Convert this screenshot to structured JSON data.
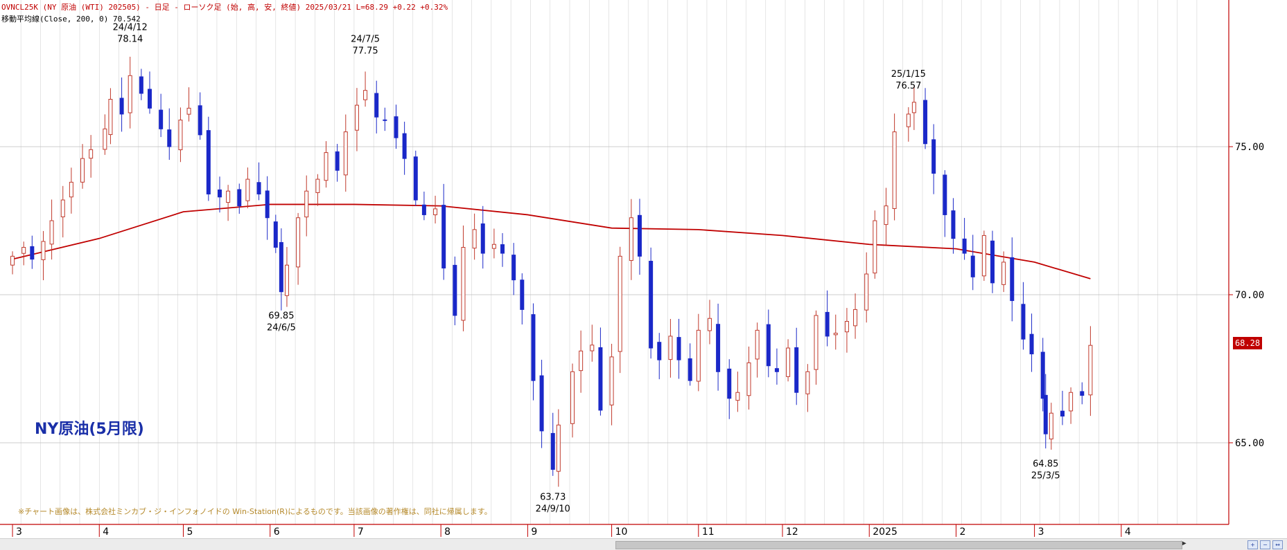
{
  "header": {
    "title": "OVNCL25K (NY 原油 (WTI) 202505) - 日足 - ローソク足 (始, 高, 安, 終値)  2025/03/21 L=68.29 +0.22  +0.32%",
    "ma_line": "移動平均線(Close, 200, 0) 70.542"
  },
  "current_price_label": "68.28",
  "big_label": "NY原油(5月限)",
  "footnote": "※チャート画像は、株式会社ミンカブ・ジ・インフォノイドの Win-Station(R)によるものです。当該画像の著作権は、同社に帰属します。",
  "colors": {
    "up": "#c0392b",
    "down": "#1a28c8",
    "ma": "#c00000",
    "grid": "#d4d4d4",
    "axis_border": "#c00000"
  },
  "chart_data": {
    "type": "candlestick",
    "x_range": [
      "2024-03-01",
      "2025-04-30"
    ],
    "ylim": [
      62.5,
      80
    ],
    "y_ticks": [
      "65.00",
      "70.00",
      "75.00"
    ],
    "month_labels": [
      {
        "label": "3",
        "date": "2024-03-01"
      },
      {
        "label": "4",
        "date": "2024-04-01"
      },
      {
        "label": "5",
        "date": "2024-05-01"
      },
      {
        "label": "6",
        "date": "2024-06-01"
      },
      {
        "label": "7",
        "date": "2024-07-01"
      },
      {
        "label": "8",
        "date": "2024-08-01"
      },
      {
        "label": "9",
        "date": "2024-09-01"
      },
      {
        "label": "10",
        "date": "2024-10-01"
      },
      {
        "label": "11",
        "date": "2024-11-01"
      },
      {
        "label": "12",
        "date": "2024-12-01"
      },
      {
        "label": "2025",
        "date": "2025-01-01"
      },
      {
        "label": "2",
        "date": "2025-02-01"
      },
      {
        "label": "3",
        "date": "2025-03-01"
      },
      {
        "label": "4",
        "date": "2025-04-01"
      }
    ],
    "annotations": [
      {
        "date": "2024-04-12",
        "value": 78.14,
        "lines": [
          "24/4/12",
          "78.14"
        ],
        "pos": "above"
      },
      {
        "date": "2024-06-05",
        "value": 69.85,
        "lines": [
          "69.85",
          "24/6/5"
        ],
        "pos": "below"
      },
      {
        "date": "2024-07-05",
        "value": 77.75,
        "lines": [
          "24/7/5",
          "77.75"
        ],
        "pos": "above"
      },
      {
        "date": "2024-09-10",
        "value": 63.73,
        "lines": [
          "63.73",
          "24/9/10"
        ],
        "pos": "below"
      },
      {
        "date": "2025-01-15",
        "value": 76.57,
        "lines": [
          "25/1/15",
          "76.57"
        ],
        "pos": "above"
      },
      {
        "date": "2025-03-05",
        "value": 64.85,
        "lines": [
          "64.85",
          "25/3/5"
        ],
        "pos": "below"
      }
    ],
    "closes": [
      [
        "2024-03-01",
        71.3
      ],
      [
        "2024-03-05",
        71.6
      ],
      [
        "2024-03-08",
        71.2
      ],
      [
        "2024-03-12",
        71.8
      ],
      [
        "2024-03-15",
        72.5
      ],
      [
        "2024-03-19",
        73.2
      ],
      [
        "2024-03-22",
        73.8
      ],
      [
        "2024-03-26",
        74.6
      ],
      [
        "2024-03-29",
        74.9
      ],
      [
        "2024-04-03",
        75.6
      ],
      [
        "2024-04-05",
        76.6
      ],
      [
        "2024-04-09",
        76.1
      ],
      [
        "2024-04-12",
        77.4
      ],
      [
        "2024-04-16",
        76.8
      ],
      [
        "2024-04-19",
        76.3
      ],
      [
        "2024-04-23",
        75.6
      ],
      [
        "2024-04-26",
        75.0
      ],
      [
        "2024-04-30",
        75.9
      ],
      [
        "2024-05-03",
        76.3
      ],
      [
        "2024-05-07",
        75.4
      ],
      [
        "2024-05-10",
        73.4
      ],
      [
        "2024-05-14",
        73.3
      ],
      [
        "2024-05-17",
        73.5
      ],
      [
        "2024-05-21",
        73.0
      ],
      [
        "2024-05-24",
        73.9
      ],
      [
        "2024-05-28",
        73.4
      ],
      [
        "2024-05-31",
        72.6
      ],
      [
        "2024-06-03",
        71.6
      ],
      [
        "2024-06-05",
        70.1
      ],
      [
        "2024-06-07",
        71.0
      ],
      [
        "2024-06-11",
        72.6
      ],
      [
        "2024-06-14",
        73.5
      ],
      [
        "2024-06-18",
        73.9
      ],
      [
        "2024-06-21",
        74.8
      ],
      [
        "2024-06-25",
        74.2
      ],
      [
        "2024-06-28",
        75.5
      ],
      [
        "2024-07-02",
        76.4
      ],
      [
        "2024-07-05",
        76.9
      ],
      [
        "2024-07-09",
        76.0
      ],
      [
        "2024-07-12",
        75.9
      ],
      [
        "2024-07-16",
        75.3
      ],
      [
        "2024-07-19",
        74.6
      ],
      [
        "2024-07-23",
        73.2
      ],
      [
        "2024-07-26",
        72.7
      ],
      [
        "2024-07-30",
        72.9
      ],
      [
        "2024-08-02",
        70.9
      ],
      [
        "2024-08-06",
        69.3
      ],
      [
        "2024-08-09",
        71.6
      ],
      [
        "2024-08-13",
        72.2
      ],
      [
        "2024-08-16",
        71.4
      ],
      [
        "2024-08-20",
        71.7
      ],
      [
        "2024-08-23",
        71.4
      ],
      [
        "2024-08-27",
        70.5
      ],
      [
        "2024-08-30",
        69.5
      ],
      [
        "2024-09-03",
        67.1
      ],
      [
        "2024-09-06",
        65.4
      ],
      [
        "2024-09-10",
        64.1
      ],
      [
        "2024-09-12",
        65.6
      ],
      [
        "2024-09-17",
        67.4
      ],
      [
        "2024-09-20",
        68.1
      ],
      [
        "2024-09-24",
        68.3
      ],
      [
        "2024-09-27",
        66.1
      ],
      [
        "2024-10-01",
        67.9
      ],
      [
        "2024-10-04",
        71.3
      ],
      [
        "2024-10-08",
        72.6
      ],
      [
        "2024-10-11",
        71.3
      ],
      [
        "2024-10-15",
        68.2
      ],
      [
        "2024-10-18",
        67.8
      ],
      [
        "2024-10-22",
        68.6
      ],
      [
        "2024-10-25",
        67.8
      ],
      [
        "2024-10-29",
        67.1
      ],
      [
        "2024-11-01",
        68.8
      ],
      [
        "2024-11-05",
        69.2
      ],
      [
        "2024-11-08",
        67.4
      ],
      [
        "2024-11-12",
        66.5
      ],
      [
        "2024-11-15",
        66.7
      ],
      [
        "2024-11-19",
        67.7
      ],
      [
        "2024-11-22",
        68.8
      ],
      [
        "2024-11-26",
        67.6
      ],
      [
        "2024-11-29",
        67.4
      ],
      [
        "2024-12-03",
        68.2
      ],
      [
        "2024-12-06",
        66.7
      ],
      [
        "2024-12-10",
        67.4
      ],
      [
        "2024-12-13",
        69.3
      ],
      [
        "2024-12-17",
        68.6
      ],
      [
        "2024-12-20",
        68.7
      ],
      [
        "2024-12-24",
        69.1
      ],
      [
        "2024-12-27",
        69.5
      ],
      [
        "2024-12-31",
        70.7
      ],
      [
        "2025-01-03",
        72.5
      ],
      [
        "2025-01-07",
        73.0
      ],
      [
        "2025-01-10",
        75.5
      ],
      [
        "2025-01-15",
        76.1
      ],
      [
        "2025-01-17",
        76.5
      ],
      [
        "2025-01-21",
        75.1
      ],
      [
        "2025-01-24",
        74.1
      ],
      [
        "2025-01-28",
        72.7
      ],
      [
        "2025-01-31",
        71.9
      ],
      [
        "2025-02-04",
        71.4
      ],
      [
        "2025-02-07",
        70.6
      ],
      [
        "2025-02-11",
        72.0
      ],
      [
        "2025-02-14",
        70.4
      ],
      [
        "2025-02-18",
        71.1
      ],
      [
        "2025-02-21",
        69.8
      ],
      [
        "2025-02-25",
        68.5
      ],
      [
        "2025-02-28",
        68.0
      ],
      [
        "2025-03-04",
        66.5
      ],
      [
        "2025-03-05",
        65.3
      ],
      [
        "2025-03-07",
        66.0
      ],
      [
        "2025-03-11",
        65.9
      ],
      [
        "2025-03-14",
        66.7
      ],
      [
        "2025-03-18",
        66.6
      ],
      [
        "2025-03-21",
        68.29
      ]
    ],
    "moving_average": {
      "name": "移動平均線(Close, 200, 0)",
      "points": [
        [
          "2024-03-01",
          71.2
        ],
        [
          "2024-04-01",
          71.9
        ],
        [
          "2024-05-01",
          72.8
        ],
        [
          "2024-06-01",
          73.05
        ],
        [
          "2024-07-01",
          73.05
        ],
        [
          "2024-08-01",
          73.0
        ],
        [
          "2024-09-01",
          72.7
        ],
        [
          "2024-10-01",
          72.25
        ],
        [
          "2024-11-01",
          72.2
        ],
        [
          "2024-12-01",
          72.0
        ],
        [
          "2025-01-01",
          71.7
        ],
        [
          "2025-02-01",
          71.55
        ],
        [
          "2025-03-01",
          71.1
        ],
        [
          "2025-03-21",
          70.54
        ]
      ]
    }
  }
}
